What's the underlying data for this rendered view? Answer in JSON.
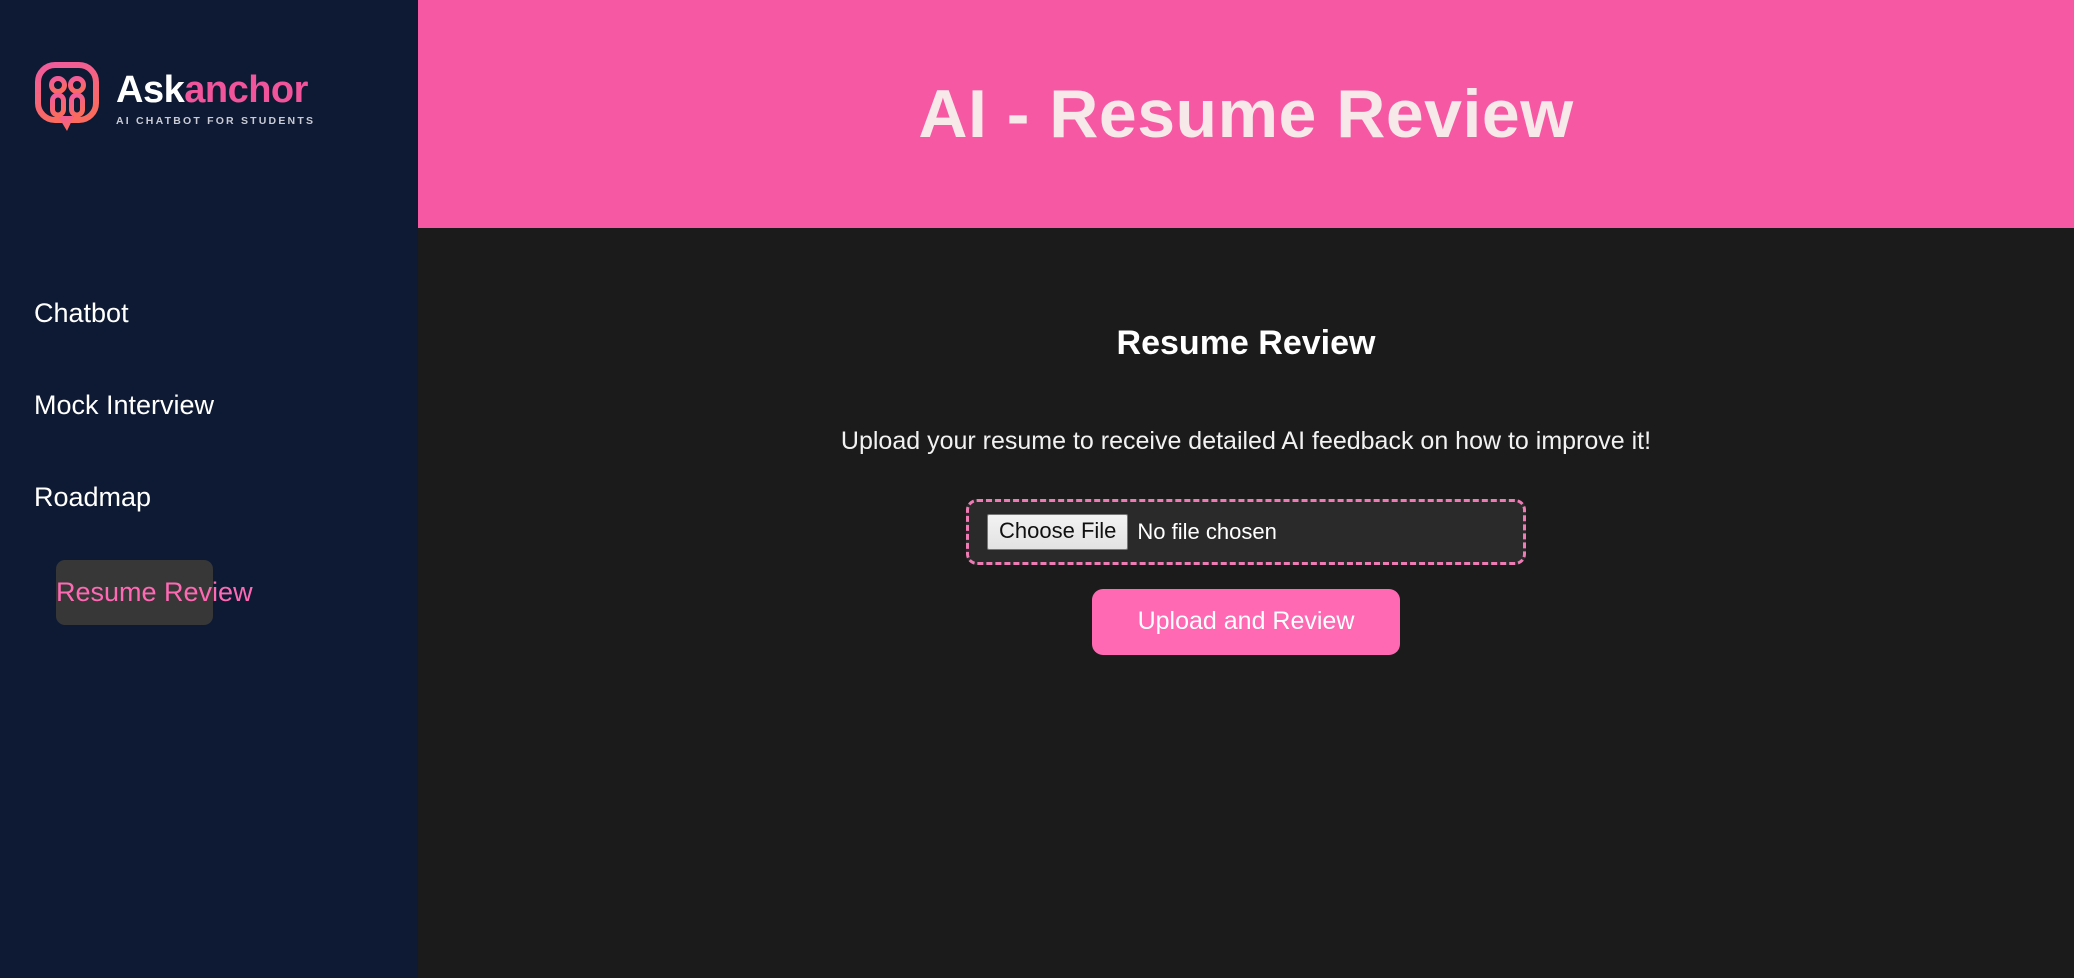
{
  "brand": {
    "logo_icon": "ask-anchor-speech-bubble-people-logo",
    "name_first": "Ask",
    "name_second": "anchor",
    "tagline": "AI CHATBOT FOR STUDENTS",
    "colors": {
      "pink": "#f2549b",
      "navy": "#0e1a33"
    }
  },
  "sidebar": {
    "items": [
      {
        "label": "Chatbot",
        "active": false
      },
      {
        "label": "Mock Interview",
        "active": false
      },
      {
        "label": "Roadmap",
        "active": false
      },
      {
        "label": "Resume Review",
        "active": true
      }
    ]
  },
  "header": {
    "title": "AI - Resume Review",
    "background": "#f758a4",
    "text_color": "#f7e9e9"
  },
  "main": {
    "section_title": "Resume Review",
    "description": "Upload your resume to receive detailed AI feedback on how to improve it!",
    "file_input": {
      "button_label": "Choose File",
      "status_text": "No file chosen",
      "border_color": "#ef7bb4"
    },
    "submit_button": {
      "label": "Upload and Review",
      "background": "#ff69b4",
      "text_color": "#ffffff"
    }
  }
}
